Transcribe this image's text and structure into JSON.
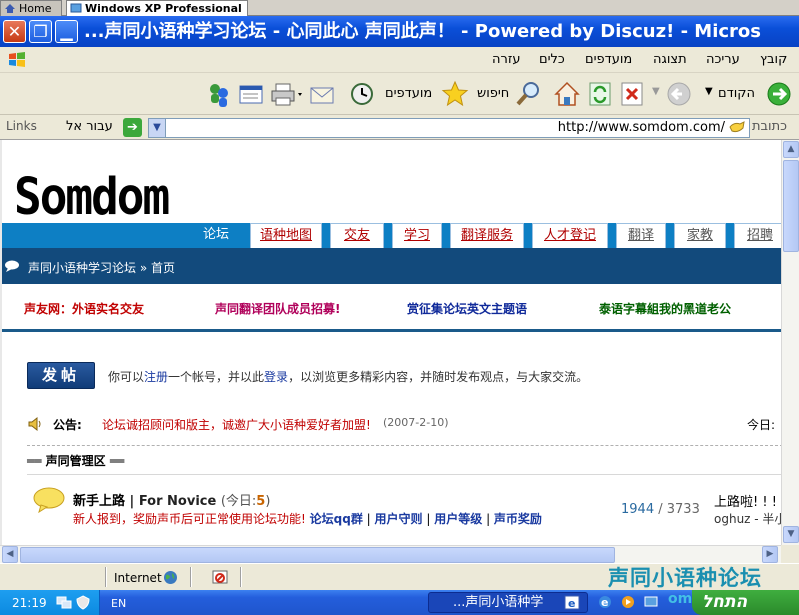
{
  "vm_tabs": [
    {
      "label": "Home"
    },
    {
      "label": "Windows XP Professional"
    }
  ],
  "window": {
    "title": "...声同小语种学习论坛 - 心同此心 声同此声！ - Powered by Discuz! - Micros"
  },
  "menu": {
    "items": [
      "קובץ",
      "עריכה",
      "תצוגה",
      "מועדפים",
      "כלים",
      "עזרה"
    ]
  },
  "toolbar": {
    "back_label": "הקודם",
    "search_label": "חיפוש",
    "favorites_label": "מועדפים"
  },
  "address": {
    "label": "כתובת",
    "url": "http://www.somdom.com/",
    "go_label": "עבור אל",
    "links_label": "Links"
  },
  "site": {
    "logo": "Somdom",
    "nav_tabs": [
      "论坛",
      "语种地图",
      "交友",
      "学习",
      "翻译服务",
      "人才登记",
      "翻译",
      "家教",
      "招聘"
    ],
    "breadcrumb": "声同小语种学习论坛 » 首页",
    "news": [
      {
        "text": "声友网：外语实名交友",
        "color": "#c00000"
      },
      {
        "text": "声同翻译团队成员招募!",
        "color": "#b0005a"
      },
      {
        "text": "赏征集论坛英文主题语",
        "color": "#102a9a"
      },
      {
        "text": "泰语字幕組我的黑道老公",
        "color": "#006000"
      }
    ],
    "post_button": "发帖",
    "welcome": {
      "before": "你可以",
      "register": "注册",
      "middle": "一个帐号，并以此",
      "login": "登录",
      "after": "，以浏览更多精彩内容，并随时发布观点，与大家交流。"
    },
    "announcement": {
      "label": "公告:",
      "text": "论坛诚招顾问和版主，诚邀广大小语种爱好者加盟!",
      "date": "(2007-2-10)",
      "today": "今日:"
    },
    "section": "声同管理区",
    "forum": {
      "name": "新手上路",
      "name_en": "| For Novice",
      "today_prefix": "(今日:",
      "today_count": "5",
      "today_suffix": ")",
      "desc": "新人报到，奖励声币后可正常使用论坛功能!",
      "links": [
        "论坛qq群",
        "用户守则",
        "用户等级",
        "声币奖励"
      ],
      "topics": "1944",
      "posts": "3733",
      "last_title": "上路啦! ! !",
      "last_user": "oghuz - 半小"
    }
  },
  "statusbar": {
    "zone": "Internet",
    "watermark": "声同小语种论坛"
  },
  "taskbar": {
    "clock": "21:19",
    "lang": "EN",
    "task": "...声同小语种学",
    "start": "התחל",
    "watermark": "omdom.com"
  },
  "colors": {
    "header_blue": "#0d7fc4",
    "breadcrumb_bg": "#124a7c",
    "title_bar": "#0a4fd8"
  }
}
